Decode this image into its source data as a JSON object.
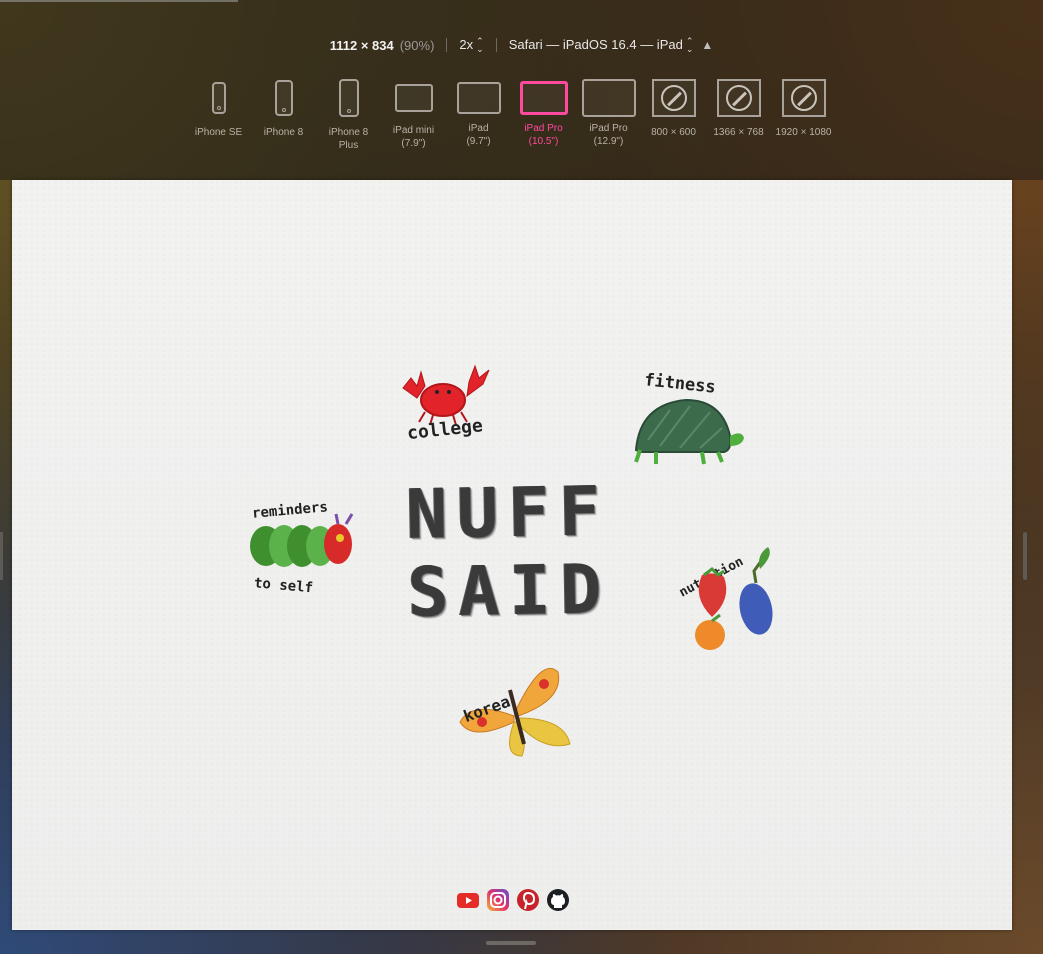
{
  "toolbar": {
    "dimensions": "1112 × 834",
    "zoom": "(90%)",
    "scale": "2x",
    "browser": "Safari — iPadOS 16.4 — iPad",
    "devices": [
      {
        "label": "iPhone SE",
        "icon": "iphone-icon",
        "active": false
      },
      {
        "label": "iPhone 8",
        "icon": "iphone-icon",
        "active": false
      },
      {
        "label": "iPhone 8\nPlus",
        "icon": "iphone-icon",
        "active": false
      },
      {
        "label": "iPad mini\n(7.9\")",
        "icon": "ipad-icon",
        "active": false
      },
      {
        "label": "iPad\n(9.7\")",
        "icon": "ipad-icon",
        "active": false
      },
      {
        "label": "iPad Pro\n(10.5\")",
        "icon": "ipad-icon",
        "active": true
      },
      {
        "label": "iPad Pro\n(12.9\")",
        "icon": "ipad-icon",
        "active": false
      },
      {
        "label": "800 × 600",
        "icon": "safari-compass-icon",
        "active": false
      },
      {
        "label": "1366 × 768",
        "icon": "safari-compass-icon",
        "active": false
      },
      {
        "label": "1920 × 1080",
        "icon": "safari-compass-icon",
        "active": false
      }
    ],
    "active_color": "#ff4aa0"
  },
  "page": {
    "headline_line1": "NUFF",
    "headline_line2": "SAID",
    "stickers": [
      {
        "id": "college",
        "label": "college",
        "icon": "crab-icon"
      },
      {
        "id": "fitness",
        "label": "fitness",
        "icon": "turtle-icon"
      },
      {
        "id": "reminder",
        "label_top": "reminders",
        "label_bottom": "to self",
        "icon": "caterpillar-icon"
      },
      {
        "id": "nutrition",
        "label": "nutrition",
        "icon": "fruit-icon"
      },
      {
        "id": "korea",
        "label": "korea",
        "icon": "butterfly-icon"
      }
    ],
    "socials": [
      "youtube-icon",
      "instagram-icon",
      "pinterest-icon",
      "github-icon"
    ]
  }
}
